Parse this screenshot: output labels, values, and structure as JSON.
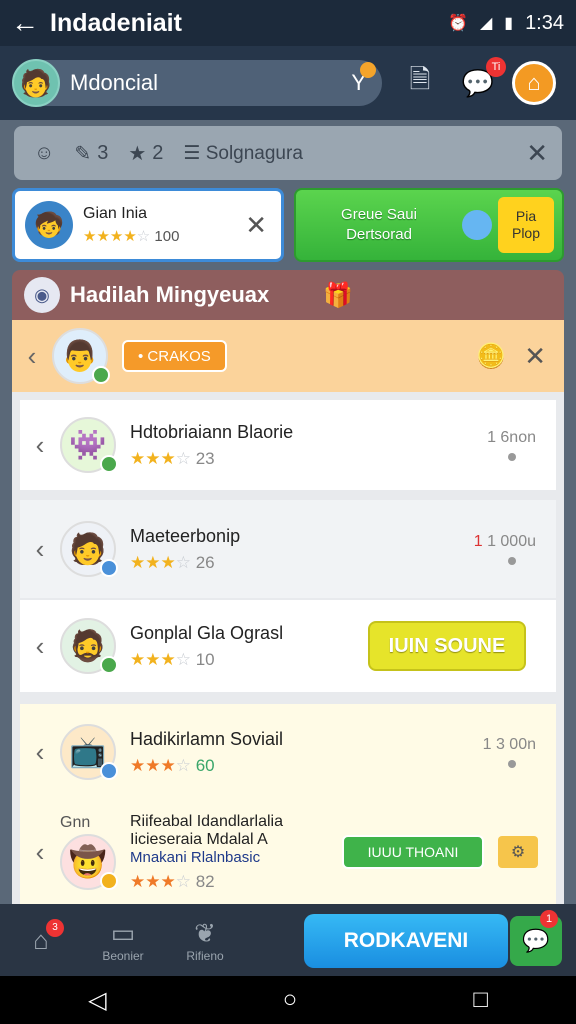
{
  "status_bar": {
    "title": "Indadeniait",
    "time": "1:34",
    "back_icon": "arrow-left-icon"
  },
  "app_bar": {
    "profile_name": "Mdoncial",
    "notif_badge": "Ti"
  },
  "search_bar": {
    "tool_count": "3",
    "star_count": "2",
    "label": "Solgnagura"
  },
  "user_card": {
    "name": "Gian Inia",
    "stars": 4,
    "points": "100"
  },
  "promo_card": {
    "text_line1": "Greue Saui",
    "text_line2": "Dertsorad",
    "button_line1": "Pia",
    "button_line2": "Plop"
  },
  "section": {
    "title": "Hadilah Mingyeuax"
  },
  "list": {
    "top_row": {
      "tag": "• CRAKOS"
    },
    "rows": [
      {
        "name": "Hdtobriaiann Blaorie",
        "rating": "23",
        "stars": 3,
        "points": "1 6non"
      },
      {
        "name": "Maeteerbonip",
        "rating": "26",
        "stars": 3,
        "points_prefix": "1",
        "points": "1 000u"
      },
      {
        "name": "Gonplal Gla Ograsl",
        "rating": "10",
        "stars": 3,
        "button": "IUIN SOUNE"
      },
      {
        "name": "Hadikirlamn Soviail",
        "rating": "60",
        "stars": 3,
        "points": "1 3 00n"
      },
      {
        "header": "Gnn",
        "name": "Riifeabal Idandlarlalia Iicieseraia Mdalal A",
        "subname": "Mnakani Rlalnbasic",
        "rating": "82",
        "stars": 3,
        "button": "IUUU THOANI"
      }
    ]
  },
  "bottom_bar": {
    "items": [
      {
        "label": "",
        "badge": "3"
      },
      {
        "label": "Beonier"
      },
      {
        "label": "Rifieno"
      }
    ],
    "cta": "RODKAVENI",
    "chat_badge": "1"
  }
}
